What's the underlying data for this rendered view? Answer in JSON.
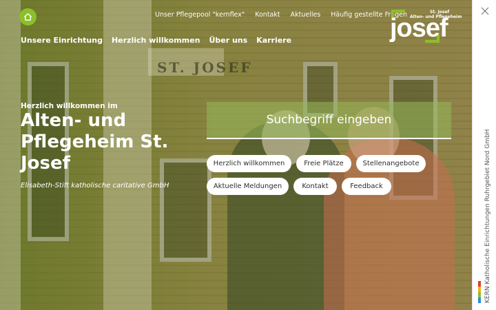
{
  "topnav": [
    "Unser Pflegepool \"kernflex\"",
    "Kontakt",
    "Aktuelles",
    "Häufig gestellte Fragen"
  ],
  "mainnav": [
    "Unsere Einrichtung",
    "Herzlich willkommen",
    "Über uns",
    "Karriere"
  ],
  "logo": {
    "word": "josef",
    "line1": "St. Josef",
    "line2": "Alten- und Pflegeheim"
  },
  "photo_sign": "ST. JOSEF",
  "hero": {
    "welcome": "Herzlich willkommen im",
    "title": "Alten- und Pflegeheim St. Josef",
    "subtitle": "Elisabeth-Stift katholische caritative GmbH"
  },
  "search": {
    "placeholder": "Suchbegriff eingeben"
  },
  "quicklinks": [
    "Herzlich willkommen",
    "Freie Plätze",
    "Stellenangebote",
    "Aktuelle Meldungen",
    "Kontakt",
    "Feedback"
  ],
  "sidebar": {
    "vertical_text": "KERN Katholische Einrichtungen Ruhrgebiet Nord GmbH",
    "stripe_colors": [
      "#e63a2e",
      "#f2b01e",
      "#8cbf2a",
      "#2a8fd6"
    ]
  },
  "colors": {
    "accent": "#8cbf2a",
    "white": "#ffffff"
  }
}
